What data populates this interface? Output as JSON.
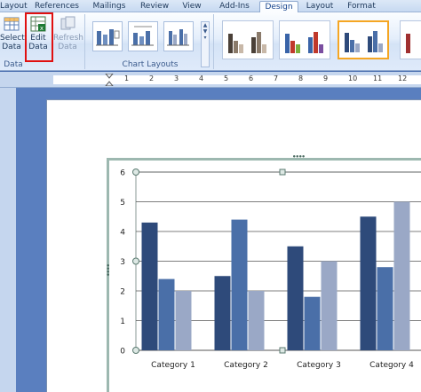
{
  "ribbon_tabs": [
    {
      "label": "Layout"
    },
    {
      "label": "References"
    },
    {
      "label": "Mailings"
    },
    {
      "label": "Review"
    },
    {
      "label": "View"
    },
    {
      "label": "Add-Ins"
    },
    {
      "label": "Design",
      "active": true
    },
    {
      "label": "Layout"
    },
    {
      "label": "Format"
    }
  ],
  "data_group": {
    "label": "Data",
    "select_data": "Select\nData",
    "edit_data": "Edit\nData",
    "refresh_data": "Refresh\nData"
  },
  "chart_layouts_group": {
    "label": "Chart Layouts"
  },
  "ruler_numbers": [
    "1",
    "2",
    "3",
    "4",
    "5",
    "6",
    "7",
    "8",
    "9",
    "10",
    "11",
    "12"
  ],
  "colors": {
    "series1": "#2e4a7a",
    "series2": "#4a6fa8",
    "series3": "#9aa8c6",
    "highlight": "#e01010",
    "selected_style": "#f5a623"
  },
  "chart_data": {
    "type": "bar",
    "categories": [
      "Category 1",
      "Category 2",
      "Category 3",
      "Category 4"
    ],
    "series": [
      {
        "values": [
          4.3,
          2.5,
          3.5,
          4.5
        ]
      },
      {
        "values": [
          2.4,
          4.4,
          1.8,
          2.8
        ]
      },
      {
        "values": [
          2.0,
          2.0,
          3.0,
          5.0
        ]
      }
    ],
    "ylim": [
      0,
      6
    ],
    "yticks": [
      "0",
      "1",
      "2",
      "3",
      "4",
      "5",
      "6"
    ],
    "grid": true
  }
}
